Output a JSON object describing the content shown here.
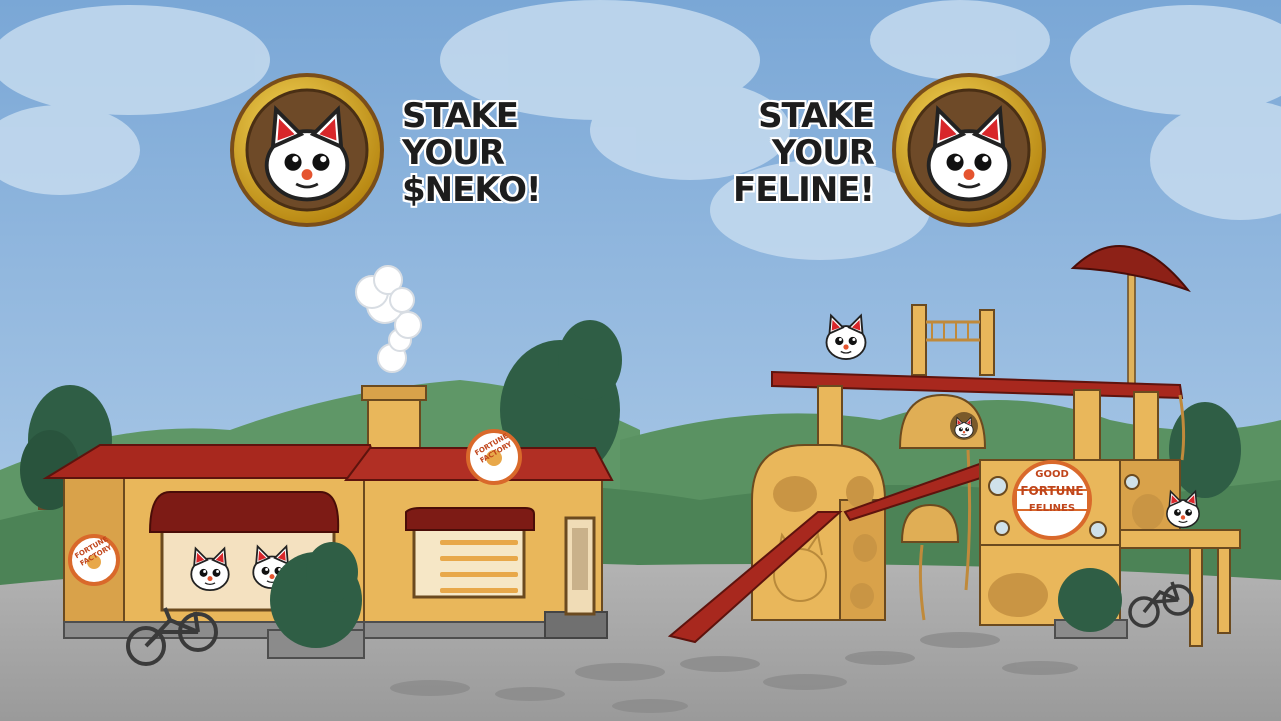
{
  "stake_neko": {
    "line1": "STAKE",
    "line2": "YOUR",
    "line3": "$NEKO!",
    "icon": "neko-coin-icon"
  },
  "stake_feline": {
    "line1": "STAKE",
    "line2": "YOUR",
    "line3": "FELINE!",
    "icon": "neko-coin-icon"
  },
  "fortune_factory": {
    "roof_sign": "FORTUNE FACTORY",
    "side_sign": "FORTUNE FACTORY"
  },
  "good_fortune_felines": {
    "sign_top": "GOOD",
    "sign_middle": "FORTUNE",
    "sign_bottom": "FELINES"
  },
  "colors": {
    "sky": "#8fb6db",
    "roof": "#a8281e",
    "wall": "#e9b75b",
    "coin_gold": "#d9a520",
    "ground": "#a9a9a9",
    "hill": "#5f9767",
    "tree": "#2f5e45"
  }
}
